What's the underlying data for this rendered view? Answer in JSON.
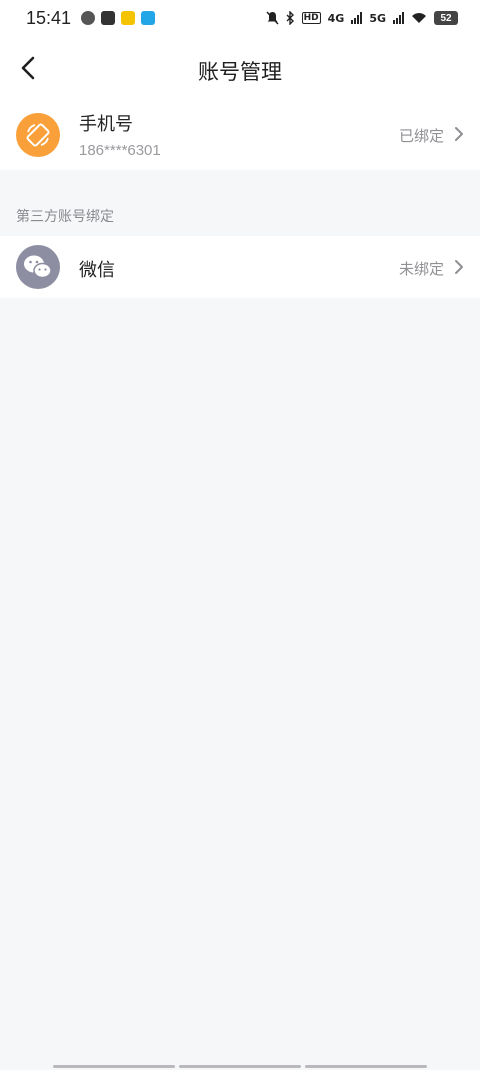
{
  "status_bar": {
    "time": "15:41",
    "network_1": "4G",
    "network_2": "5G",
    "hd_label": "HD",
    "battery": "52"
  },
  "header": {
    "title": "账号管理",
    "back_icon": "chevron-left-icon"
  },
  "phone": {
    "title": "手机号",
    "number": "186****6301",
    "status": "已绑定",
    "icon": "phone-rotate-icon",
    "icon_bg": "#f9a03a"
  },
  "third_party": {
    "section_label": "第三方账号绑定",
    "items": [
      {
        "title": "微信",
        "status": "未绑定",
        "icon": "wechat-icon",
        "icon_bg": "#8e8ea3"
      }
    ]
  }
}
